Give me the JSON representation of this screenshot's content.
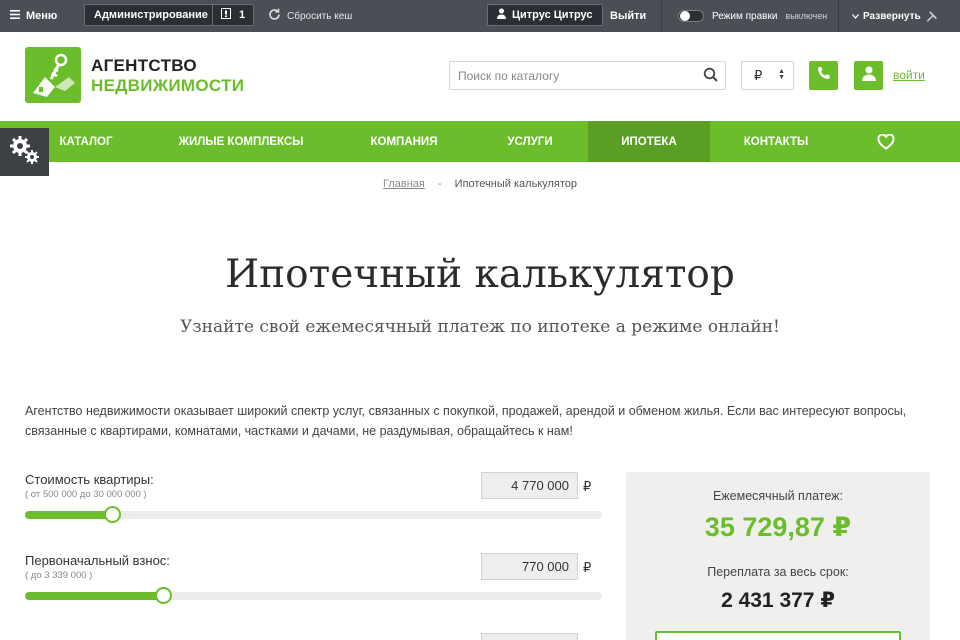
{
  "admin_bar": {
    "menu": "Меню",
    "admin": "Администрирование",
    "count": "1",
    "clear_cache": "Сбросить кеш",
    "user": "Цитрус Цитрус",
    "exit": "Выйти",
    "edit_mode": "Режим правки",
    "edit_state": "выключен",
    "expand": "Развернуть"
  },
  "logo": {
    "line1": "АГЕНТСТВО",
    "line2": "НЕДВИЖИМОСТИ"
  },
  "search": {
    "placeholder": "Поиск по каталогу"
  },
  "currency": {
    "selected": "₽"
  },
  "login": "войти",
  "nav": {
    "items": [
      {
        "label": "Каталог"
      },
      {
        "label": "Жилые комплексы"
      },
      {
        "label": "Компания"
      },
      {
        "label": "Услуги"
      },
      {
        "label": "Ипотека"
      },
      {
        "label": "Контакты"
      }
    ],
    "active_index": 4
  },
  "breadcrumb": {
    "home": "Главная",
    "separator": "-",
    "current": "Ипотечный калькулятор"
  },
  "page": {
    "title": "Ипотечный калькулятор",
    "subtitle": "Узнайте свой ежемесячный платеж по ипотеке а режиме онлайн!",
    "intro": "Агентство недвижимости оказывает широкий спектр услуг, связанных с покупкой, продажей, арендой и обменом жилья. Если вас интересуют вопросы, связанные с квартирами, комнатами, частками и дачами, не раздумывая, обращайтесь к нам!"
  },
  "calculator": {
    "price": {
      "label": "Стоимость квартиры:",
      "range": "( от 500 000 до 30 000 000 )",
      "value": "4 770 000",
      "currency": "₽",
      "position": 0.15
    },
    "downpayment": {
      "label": "Первоначальный взнос:",
      "range": "( до 3 339 000 )",
      "value": "770 000",
      "currency": "₽",
      "position": 0.24
    }
  },
  "result": {
    "monthly_label": "Ежемесячный платеж:",
    "monthly_value": "35 729,87 ₽",
    "overpay_label": "Переплата за весь срок:",
    "overpay_value": "2 431 377 ₽"
  },
  "colors": {
    "accent": "#6cbd2c",
    "accent_dark": "#5a9e24",
    "admin_bar": "#4b4f55"
  }
}
